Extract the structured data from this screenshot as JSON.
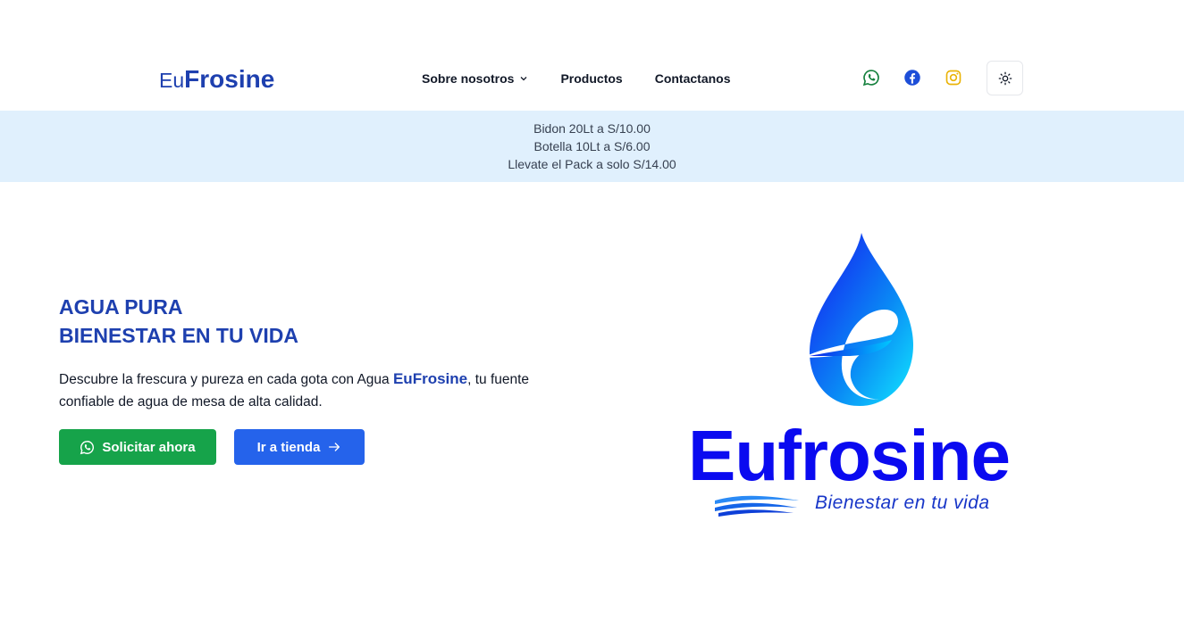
{
  "brand": {
    "prefix": "Eu",
    "name": "Frosine"
  },
  "nav": {
    "about": "Sobre nosotros",
    "products": "Productos",
    "contact": "Contactanos"
  },
  "socials": [
    {
      "icon": "whatsapp-icon",
      "color": "#15803d"
    },
    {
      "icon": "facebook-icon",
      "color": "#1d4ed8"
    },
    {
      "icon": "instagram-icon",
      "color": "#eab308"
    }
  ],
  "theme_toggle": {
    "icon": "sun-icon"
  },
  "promo": [
    "Bidon 20Lt a S/10.00",
    "Botella 10Lt a S/6.00",
    "Llevate el Pack a solo S/14.00"
  ],
  "hero": {
    "title_line1": "AGUA PURA",
    "title_line2": "BIENESTAR EN TU VIDA",
    "desc_before": "Descubre la frescura y pureza en cada gota con Agua ",
    "desc_brand_prefix": "Eu",
    "desc_brand_name": "Frosine",
    "desc_after": ", tu fuente confiable de agua de mesa de alta calidad.",
    "cta_primary": "Solicitar ahora",
    "cta_secondary": "Ir a tienda"
  },
  "logo": {
    "word": "Eufrosine",
    "tagline": "Bienestar en tu vida"
  },
  "colors": {
    "brand_blue": "#1e40af",
    "promo_bg": "#e0f0fd",
    "cta_green": "#16a34a",
    "cta_blue": "#2563eb",
    "logo_blue": "#0a0af0"
  }
}
